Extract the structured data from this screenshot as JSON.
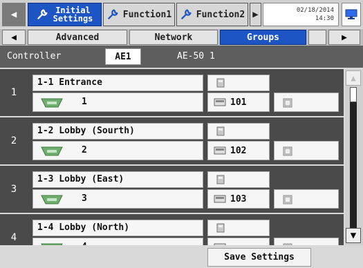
{
  "top_tabs": [
    {
      "label": "Initial Settings"
    },
    {
      "label": "Function1"
    },
    {
      "label": "Function2"
    }
  ],
  "clock": {
    "date": "02/18/2014",
    "time": "14:30"
  },
  "sub_tabs": [
    {
      "label": "Advanced"
    },
    {
      "label": "Network"
    },
    {
      "label": "Groups"
    }
  ],
  "controller": {
    "label": "Controller",
    "value": "AE1",
    "sub": "AE-50 1"
  },
  "groups": [
    {
      "num": "1",
      "name": "1-1 Entrance",
      "unit": "1",
      "id": "101"
    },
    {
      "num": "2",
      "name": "1-2 Lobby (Sourth)",
      "unit": "2",
      "id": "102"
    },
    {
      "num": "3",
      "name": "1-3 Lobby (East)",
      "unit": "3",
      "id": "103"
    },
    {
      "num": "4",
      "name": "1-4 Lobby (North)",
      "unit": "4",
      "id": ""
    }
  ],
  "buttons": {
    "save": "Save Settings"
  },
  "icons": {
    "tab": "wrench-icon",
    "unit": "indoor-unit-icon",
    "remote": "remote-controller-icon",
    "panel": "controller-panel-icon",
    "system": "system-icon"
  },
  "colors": {
    "active_tab": "#1d55c4",
    "row_bg": "#4a4a4a",
    "accent": "#2f6be8"
  }
}
